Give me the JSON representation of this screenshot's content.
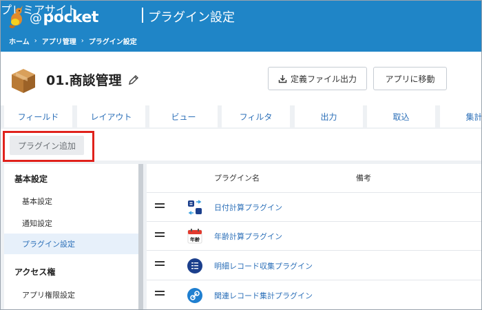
{
  "header": {
    "brand_at": "@",
    "brand_name": "pocket",
    "brand_sub": "プレミアサイト",
    "title": "プラグイン設定",
    "breadcrumbs": [
      "ホーム",
      "アプリ管理",
      "プラグイン設定"
    ],
    "bg_color": "#1f85c7"
  },
  "app": {
    "title": "01.商談管理",
    "export_button": "定義ファイル出力",
    "move_button": "アプリに移動"
  },
  "tabs": [
    "フィールド",
    "レイアウト",
    "ビュー",
    "フィルタ",
    "出力",
    "取込",
    "集計"
  ],
  "add_button": "プラグイン追加",
  "highlight_color": "#e0211b",
  "sidebar": {
    "sections": [
      {
        "heading": "基本設定",
        "items": [
          "基本設定",
          "通知設定",
          "プラグイン設定"
        ]
      },
      {
        "heading": "アクセス権",
        "items": [
          "アプリ権限設定"
        ]
      }
    ],
    "active_item": "プラグイン設定"
  },
  "table": {
    "columns": [
      "プラグイン名",
      "備考"
    ],
    "rows": [
      {
        "name": "日付計算プラグイン",
        "icon": "date-calc-icon",
        "icon_label": ""
      },
      {
        "name": "年齢計算プラグイン",
        "icon": "calendar-age-icon",
        "icon_label": "年齢"
      },
      {
        "name": "明細レコード収集プラグイン",
        "icon": "list-collect-icon",
        "icon_label": ""
      },
      {
        "name": "関連レコード集計プラグイン",
        "icon": "link-aggregate-icon",
        "icon_label": ""
      }
    ]
  }
}
